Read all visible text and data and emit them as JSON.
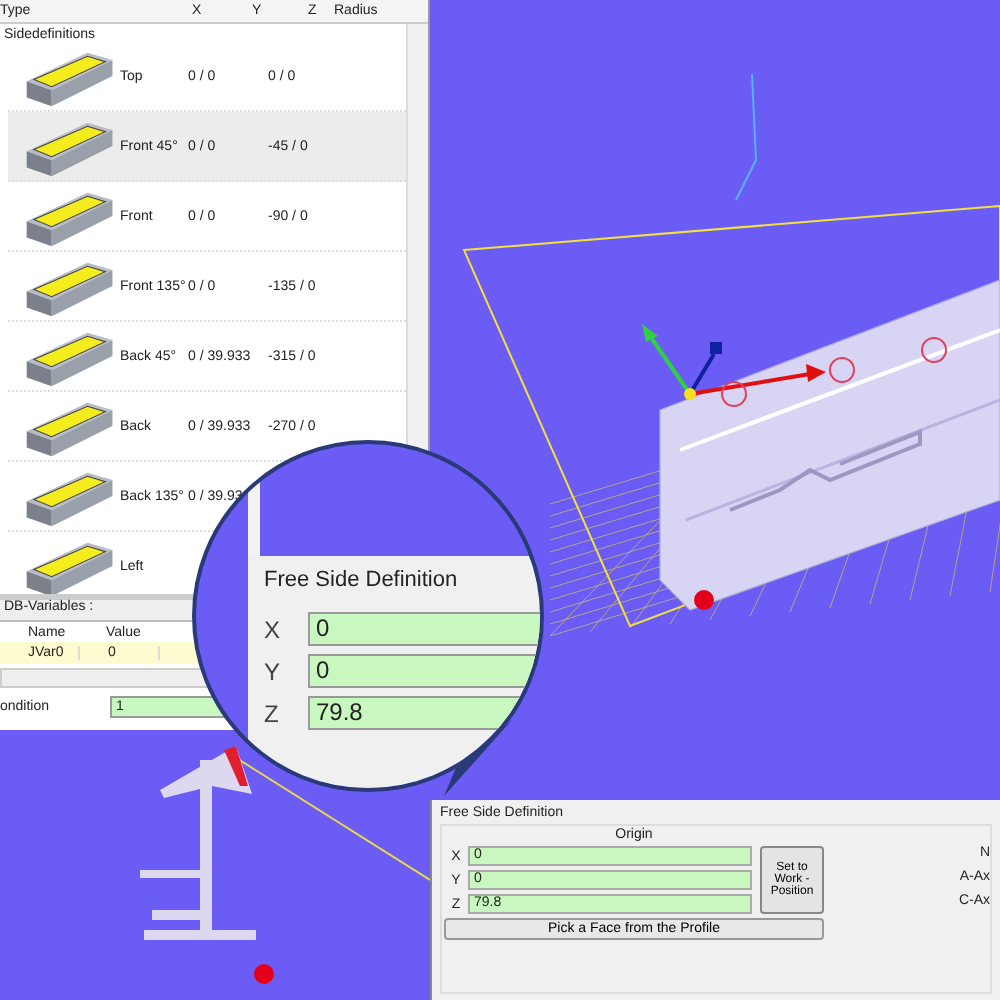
{
  "side_table": {
    "columns": [
      "Type",
      "X",
      "Y",
      "Z",
      "Radius"
    ],
    "group": "Sidedefinitions",
    "rows": [
      {
        "type": "Top",
        "x": "0 / 0",
        "y": "0 / 0",
        "selected": false
      },
      {
        "type": "Front  45°",
        "x": "0 / 0",
        "y": "-45 / 0",
        "selected": true
      },
      {
        "type": "Front",
        "x": "0 / 0",
        "y": "-90 / 0",
        "selected": false
      },
      {
        "type": "Front 135°",
        "x": "0 / 0",
        "y": "-135 / 0",
        "selected": false
      },
      {
        "type": "Back  45°",
        "x": "0 / 39.933",
        "y": "-315 / 0",
        "selected": false
      },
      {
        "type": "Back",
        "x": "0 / 39.933",
        "y": "-270 / 0",
        "selected": false
      },
      {
        "type": "Back  135°",
        "x": "0 / 39.93",
        "selected": false
      },
      {
        "type": "Left",
        "selected": false
      }
    ]
  },
  "variables": {
    "title": "DB-Variables :",
    "columns": [
      "Name",
      "Value"
    ],
    "rows": [
      {
        "name": "JVar0",
        "value": "0"
      }
    ]
  },
  "condition": {
    "label": "ondition",
    "value": "1"
  },
  "magnifier": {
    "title": "Free Side Definition",
    "fields": [
      {
        "label": "X",
        "value": "0"
      },
      {
        "label": "Y",
        "value": "0"
      },
      {
        "label": "Z",
        "value": "79.8"
      }
    ]
  },
  "free_side_definition": {
    "title": "Free Side Definition",
    "group": "Origin",
    "fields": [
      {
        "label": "X",
        "value": "0"
      },
      {
        "label": "Y",
        "value": "0"
      },
      {
        "label": "Z",
        "value": "79.8"
      }
    ],
    "set_button": "Set to Work - Position",
    "pick_button": "Pick a Face from the Profile",
    "axes": [
      "N",
      "A-Ax",
      "C-Ax"
    ]
  }
}
